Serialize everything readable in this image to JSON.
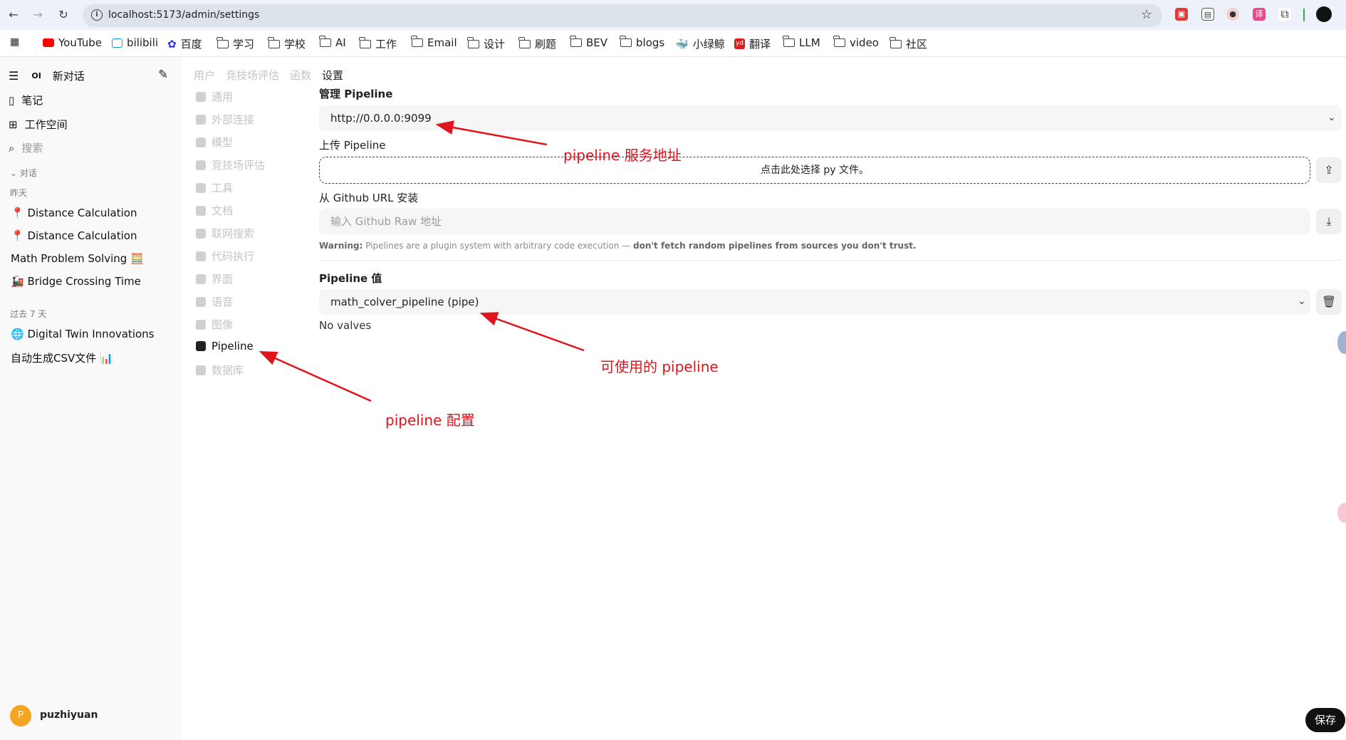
{
  "browser": {
    "url": "localhost:5173/admin/settings",
    "bookmarks": [
      "YouTube",
      "bilibili",
      "百度",
      "学习",
      "学校",
      "AI",
      "工作",
      "Email",
      "设计",
      "刷题",
      "BEV",
      "blogs",
      "小绿鲸",
      "翻译",
      "LLM",
      "video",
      "社区"
    ]
  },
  "sidebar": {
    "new_chat": "新对话",
    "logo": "OI",
    "notes": "笔记",
    "workspace": "工作空间",
    "search_placeholder": "搜索",
    "section_chats": "对话",
    "section_yesterday": "昨天",
    "yesterday_items": [
      "📍 Distance Calculation",
      "📍 Distance Calculation",
      "Math Problem Solving 🧮",
      "🚂 Bridge Crossing Time"
    ],
    "section_last7": "过去 7 天",
    "last7_items": [
      "🌐 Digital Twin Innovations",
      "自动生成CSV文件 📊"
    ],
    "user_initial": "P",
    "user_name": "puzhiyuan"
  },
  "top_tabs": [
    "用户",
    "竞技场评估",
    "函数",
    "设置"
  ],
  "settings_nav": [
    "通用",
    "外部连接",
    "模型",
    "竞技场评估",
    "工具",
    "文档",
    "联网搜索",
    "代码执行",
    "界面",
    "语音",
    "图像",
    "Pipeline",
    "数据库"
  ],
  "pipeline": {
    "manage_label": "管理 Pipeline",
    "manage_value": "http://0.0.0.0:9099",
    "upload_label": "上传 Pipeline",
    "upload_text": "点击此处选择 py 文件。",
    "github_label": "从 Github URL 安装",
    "github_placeholder": "输入 Github Raw 地址",
    "warning_prefix": "Warning:",
    "warning_text": " Pipelines are a plugin system with arbitrary code execution — ",
    "warning_bold": "don't fetch random pipelines from sources you don't trust.",
    "values_label": "Pipeline 值",
    "values_selected": "math_colver_pipeline (pipe)",
    "no_valves": "No valves"
  },
  "annotations": {
    "server": "pipeline 服务地址",
    "available": "可使用的 pipeline",
    "config": "pipeline 配置"
  },
  "save_label": "保存",
  "colors": {
    "annotation": "#e0141c",
    "accent": "#111111",
    "avatar": "#f5a524"
  }
}
